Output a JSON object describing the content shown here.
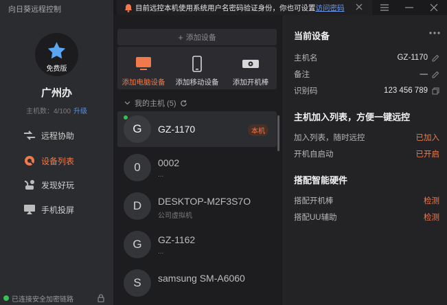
{
  "app": {
    "title": "向日葵远程控制"
  },
  "profile": {
    "plan": "免费版",
    "group_name": "广州办",
    "host_count_label": "主机数：4/100",
    "upgrade_label": "升级"
  },
  "nav": [
    {
      "label": "远程协助",
      "icon": "remote-assist-icon"
    },
    {
      "label": "设备列表",
      "icon": "device-list-icon",
      "active": true
    },
    {
      "label": "发现好玩",
      "icon": "discover-icon"
    },
    {
      "label": "手机投屏",
      "icon": "screen-cast-icon"
    }
  ],
  "status": {
    "label": "已连接安全加密链路"
  },
  "notice": {
    "text": "目前远控本机使用系统用户名密码验证身份，你也可设置",
    "link": "访问密码"
  },
  "add_device": {
    "button_label": "添加设备",
    "options": [
      {
        "label": "添加电脑设备",
        "icon": "computer-icon"
      },
      {
        "label": "添加移动设备",
        "icon": "mobile-icon"
      },
      {
        "label": "添加开机棒",
        "icon": "boot-stick-icon"
      }
    ]
  },
  "hosts": {
    "section_label": "我的主机 (5)",
    "items": [
      {
        "initial": "G",
        "name": "GZ-1170",
        "sub": "",
        "badge": "本机",
        "selected": true,
        "online": true
      },
      {
        "initial": "0",
        "name": "0002",
        "sub": "..."
      },
      {
        "initial": "D",
        "name": "DESKTOP-M2F3S7O",
        "sub": "公司虚拟机"
      },
      {
        "initial": "G",
        "name": "GZ-1162",
        "sub": "..."
      },
      {
        "initial": "S",
        "name": "samsung SM-A6060",
        "sub": ""
      }
    ]
  },
  "detail": {
    "current_title": "当前设备",
    "fields": [
      {
        "key": "主机名",
        "value": "GZ-1170"
      },
      {
        "key": "备注",
        "value": "—"
      },
      {
        "key": "识别码",
        "value": "123 456 789"
      }
    ],
    "join_title": "主机加入列表，方便一键远控",
    "join_fields": [
      {
        "key": "加入列表，随时远控",
        "value": "已加入"
      },
      {
        "key": "开机自启动",
        "value": "已开启"
      }
    ],
    "hw_title": "搭配智能硬件",
    "hw_fields": [
      {
        "key": "搭配开机棒",
        "value": "检测"
      },
      {
        "key": "搭配UU辅助",
        "value": "检测"
      }
    ]
  },
  "colors": {
    "accent": "#f07a4c",
    "link": "#6a9bf0",
    "online": "#35c253"
  }
}
